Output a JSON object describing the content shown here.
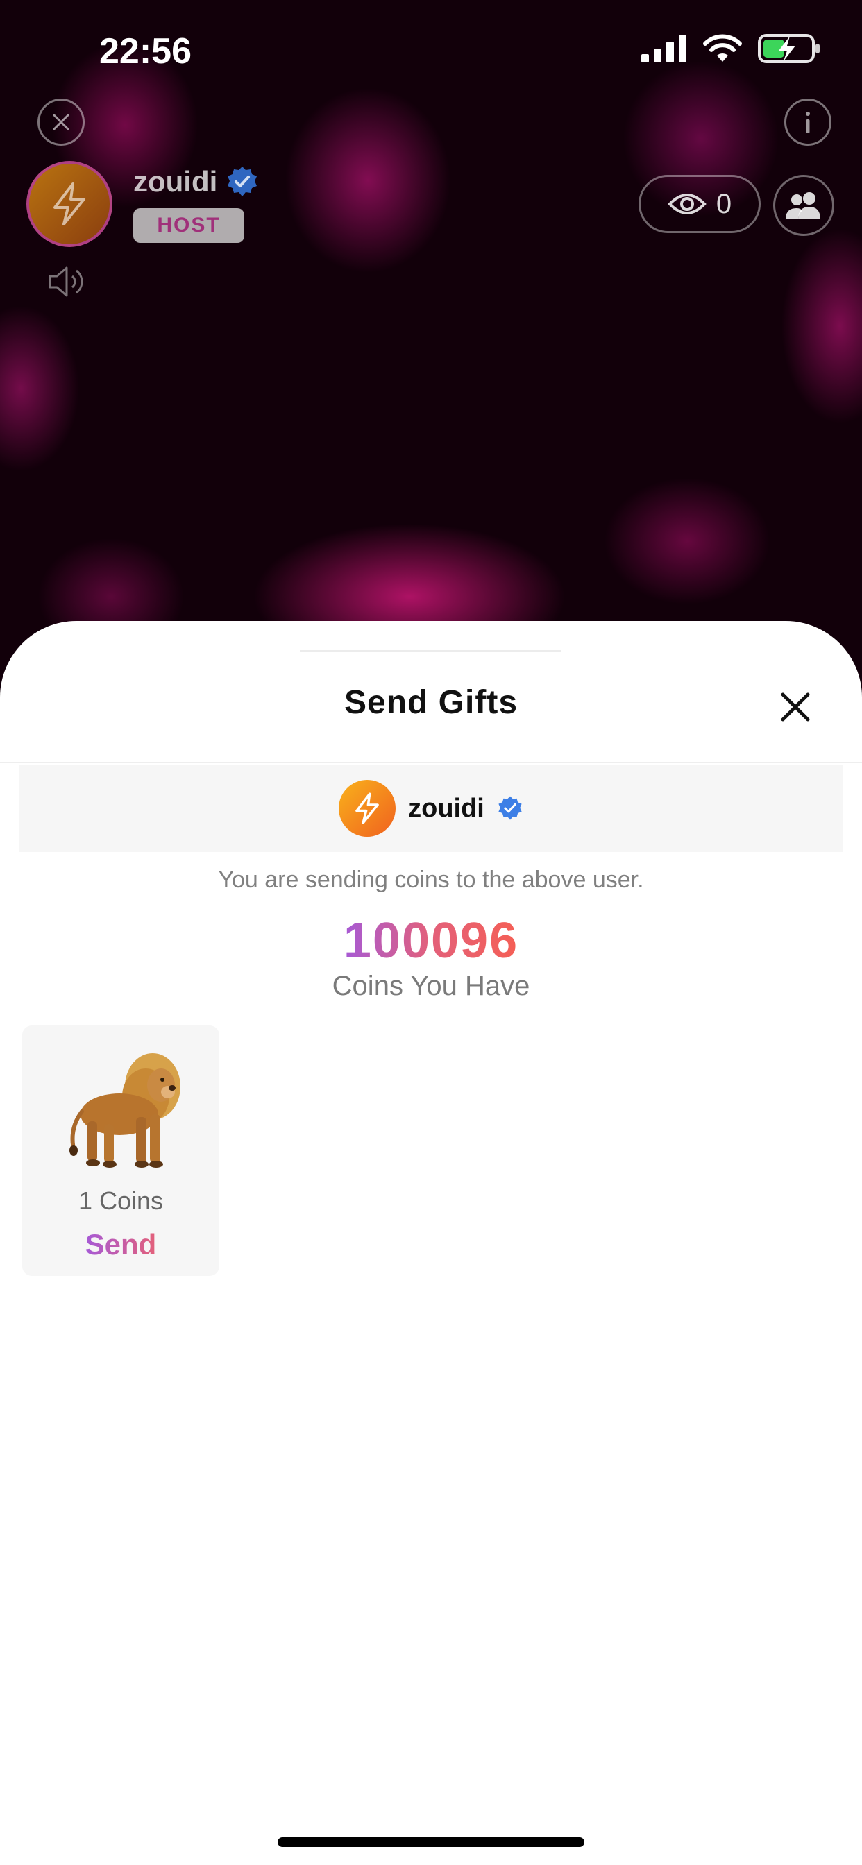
{
  "status_bar": {
    "time": "22:56",
    "icons": [
      "cellular-signal-icon",
      "wifi-icon",
      "battery-charging-icon"
    ]
  },
  "stream": {
    "host": {
      "name": "zouidi",
      "verified": true,
      "badge": "HOST",
      "avatar_icon": "lightning-icon"
    },
    "viewer_count": "0",
    "icons": [
      "close-icon",
      "info-icon",
      "speaker-icon",
      "eye-icon",
      "users-icon"
    ]
  },
  "gift_sheet": {
    "title": "Send Gifts",
    "recipient": {
      "name": "zouidi",
      "verified": true
    },
    "info_text": "You are sending coins to the above user.",
    "coins_balance": "100096",
    "coins_label": "Coins You Have",
    "gifts": [
      {
        "icon": "lion-gift-icon",
        "price": "1 Coins",
        "action": "Send"
      }
    ]
  },
  "colors": {
    "accent_gradient_start": "#a65ad6",
    "accent_gradient_end": "#f55f55",
    "verified_badge": "#3d7fe6"
  }
}
